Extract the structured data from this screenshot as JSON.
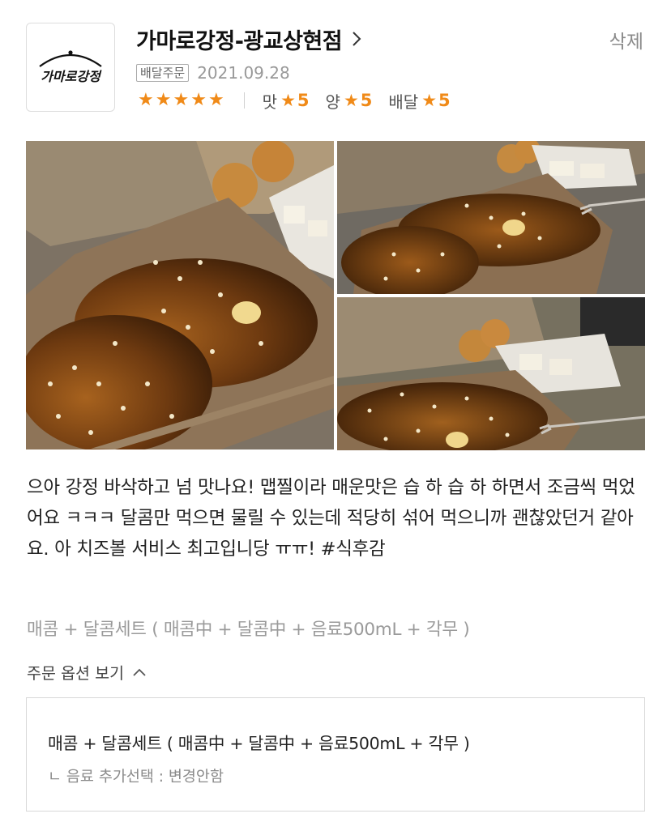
{
  "store": {
    "logo_text": "가마로강정",
    "name": "가마로강정-광교상현점",
    "delete_label": "삭제"
  },
  "order": {
    "type_badge": "배달주문",
    "date": "2021.09.28"
  },
  "rating": {
    "overall_stars": 5,
    "sub_ratings": [
      {
        "label": "맛",
        "value": "5"
      },
      {
        "label": "양",
        "value": "5"
      },
      {
        "label": "배달",
        "value": "5"
      }
    ],
    "star_color": "#f08a18"
  },
  "photos": [
    {
      "name": "review-photo-1"
    },
    {
      "name": "review-photo-2"
    },
    {
      "name": "review-photo-3"
    }
  ],
  "review": {
    "text": "으아 강정 바삭하고 넘 맛나요! 맵찔이라 매운맛은 습 하 습 하 하면서 조금씩 먹었어요 ㅋㅋㅋ 달콤만 먹으면 물릴 수 있는데 적당히 섞어 먹으니까 괜찮았던거 같아요. 아 치즈볼 서비스 최고입니당 ㅠㅠ! #식후감"
  },
  "menu": {
    "summary": "매콤 + 달콤세트 ( 매콤中 + 달콤中 + 음료500mL + 각무 )",
    "options_toggle": "주문 옵션 보기",
    "options": {
      "main": "매콤 + 달콤세트 ( 매콤中 + 달콤中 + 음료500mL + 각무 )",
      "sub": "ㄴ 음료 추가선택 : 변경안함"
    }
  }
}
